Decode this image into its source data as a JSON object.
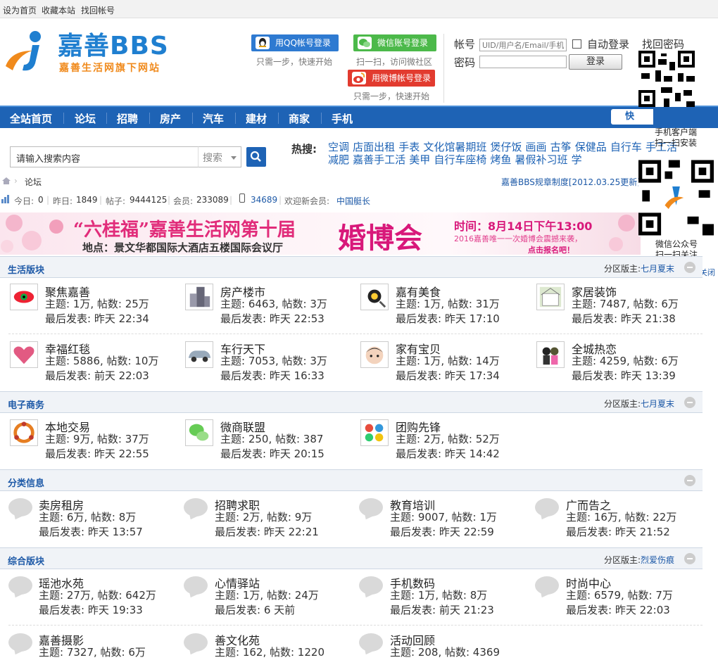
{
  "topbar": {
    "set_home": "设为首页",
    "bookmark": "收藏本站",
    "recover": "找回帐号"
  },
  "header": {
    "logo_text": "嘉善BBS",
    "logo_sub": "嘉善生活网旗下网站",
    "qq_login": "用QQ帐号登录",
    "wechat_login": "微信账号登录",
    "weibo_login": "用微博帐号登录",
    "hint_fast": "只需一步，快速开始",
    "hint_scan": "扫一扫，访问微社区",
    "account_label": "帐号",
    "account_placeholder": "UID/用户名/Email/手机",
    "password_label": "密码",
    "auto_login": "自动登录",
    "find_password": "找回密码",
    "login_button": "登录"
  },
  "nav": {
    "items": [
      "全站首页",
      "论坛",
      "招聘",
      "房产",
      "汽车",
      "建材",
      "商家",
      "手机"
    ],
    "fast": "快"
  },
  "search": {
    "placeholder": "请输入搜索内容",
    "select": "搜索",
    "hot_label": "热搜:",
    "hot_words": [
      "空调",
      "店面出租",
      "手表",
      "文化馆暑期班",
      "煲仔饭",
      "画画",
      "古筝",
      "保健品",
      "自行车",
      "手工活",
      "减肥",
      "嘉善手工活",
      "美甲",
      "自行车座椅",
      "烤鱼",
      "暑假补习班",
      "学"
    ]
  },
  "crumb": {
    "current": "论坛",
    "rules": "嘉善BBS规章制度[2012.03.25更新]"
  },
  "stats": {
    "today_label": "今日:",
    "today": "0",
    "yesterday_label": "昨日:",
    "yesterday": "1849",
    "posts_label": "帖子:",
    "posts": "9444125",
    "members_label": "会员:",
    "members": "233089",
    "mobile": "34689",
    "welcome": "欢迎新会员:",
    "new_member": "中国艇长"
  },
  "banner": {
    "title": "“六桂福”嘉善生活网第十届",
    "big": "婚博会",
    "time": "时间：8月14日下午13:00",
    "place": "地点：景文华都国际大酒店五楼国际会议厅",
    "promo1": "2016嘉善唯一一次婚博会震撼来袭，",
    "promo2": "点击报名吧！"
  },
  "qr": {
    "app_caption1": "手机客户端",
    "app_caption2": "扫一扫安装",
    "wechat_caption1": "微信公众号",
    "wechat_caption2": "扫一扫关注",
    "close": "关闭"
  },
  "sections": [
    {
      "title": "生活版块",
      "mod_label": "分区版主:",
      "mod": "七月夏末",
      "forums": [
        {
          "name": "聚焦嘉善",
          "meta": "主题: 1万, 帖数: 25万",
          "last": "最后发表: 昨天 22:34",
          "icon": "eye-icon"
        },
        {
          "name": "房产楼市",
          "meta": "主题: 6463, 帖数: 3万",
          "last": "最后发表: 昨天 22:53",
          "icon": "building-icon"
        },
        {
          "name": "嘉有美食",
          "meta": "主题: 1万, 帖数: 31万",
          "last": "最后发表: 昨天 17:10",
          "icon": "food-icon"
        },
        {
          "name": "家居装饰",
          "meta": "主题: 7487, 帖数: 6万",
          "last": "最后发表: 昨天 21:38",
          "icon": "house-icon"
        },
        {
          "name": "幸福红毯",
          "meta": "主题: 5886, 帖数: 10万",
          "last": "最后发表: 前天 22:03",
          "icon": "heart-icon"
        },
        {
          "name": "车行天下",
          "meta": "主题: 7053, 帖数: 3万",
          "last": "最后发表: 昨天 16:33",
          "icon": "car-icon"
        },
        {
          "name": "家有宝贝",
          "meta": "主题: 1万, 帖数: 14万",
          "last": "最后发表: 昨天 17:34",
          "icon": "baby-icon"
        },
        {
          "name": "全城热恋",
          "meta": "主题: 4259, 帖数: 6万",
          "last": "最后发表: 昨天 13:39",
          "icon": "couple-icon"
        }
      ]
    },
    {
      "title": "电子商务",
      "mod_label": "分区版主:",
      "mod": "七月夏末",
      "forums": [
        {
          "name": "本地交易",
          "meta": "主题: 9万, 帖数: 37万",
          "last": "最后发表: 昨天 22:55",
          "icon": "trade-icon"
        },
        {
          "name": "微商联盟",
          "meta": "主题: 250, 帖数: 387",
          "last": "最后发表: 昨天 20:15",
          "icon": "weishang-icon"
        },
        {
          "name": "团购先锋",
          "meta": "主题: 2万, 帖数: 52万",
          "last": "最后发表: 昨天 14:42",
          "icon": "groupbuy-icon"
        }
      ]
    },
    {
      "title": "分类信息",
      "forums": [
        {
          "name": "卖房租房",
          "meta": "主题: 6万, 帖数: 8万",
          "last": "最后发表: 昨天 13:57"
        },
        {
          "name": "招聘求职",
          "meta": "主题: 2万, 帖数: 9万",
          "last": "最后发表: 昨天 22:21"
        },
        {
          "name": "教育培训",
          "meta": "主题: 9007, 帖数: 1万",
          "last": "最后发表: 昨天 22:59"
        },
        {
          "name": "广而告之",
          "meta": "主题: 16万, 帖数: 22万",
          "last": "最后发表: 昨天 21:52"
        }
      ]
    },
    {
      "title": "综合版块",
      "mod_label": "分区版主:",
      "mod": "烈爱伤痕",
      "forums": [
        {
          "name": "瑶池水苑",
          "meta": "主题: 27万, 帖数: 642万",
          "last": "最后发表: 昨天 19:33"
        },
        {
          "name": "心情驿站",
          "meta": "主题: 1万, 帖数: 24万",
          "last": "最后发表: 6 天前"
        },
        {
          "name": "手机数码",
          "meta": "主题: 1万, 帖数: 8万",
          "last": "最后发表: 前天 21:23"
        },
        {
          "name": "时尚中心",
          "meta": "主题: 6579, 帖数: 7万",
          "last": "最后发表: 昨天 22:03"
        },
        {
          "name": "嘉善摄影",
          "meta": "主题: 7327, 帖数: 6万"
        },
        {
          "name": "善文化苑",
          "meta": "主题: 162, 帖数: 1220"
        },
        {
          "name": "活动回顾",
          "meta": "主题: 208, 帖数: 4369"
        }
      ]
    }
  ]
}
